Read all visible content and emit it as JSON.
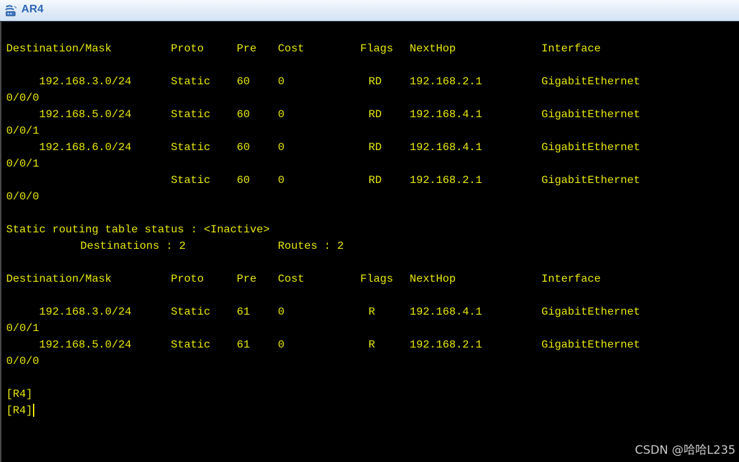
{
  "window": {
    "title": "AR4",
    "icon": "router-icon"
  },
  "table1": {
    "headers": {
      "destination": "Destination/Mask",
      "proto": "Proto",
      "pre": "Pre",
      "cost": "Cost",
      "flags": "Flags",
      "nexthop": "NextHop",
      "interface": "Interface"
    },
    "rows": [
      {
        "destination": "192.168.3.0/24",
        "proto": "Static",
        "pre": "60",
        "cost": "0",
        "flags": "RD",
        "nexthop": "192.168.2.1",
        "interface": "GigabitEthernet",
        "interface_cont": "0/0/0"
      },
      {
        "destination": "192.168.5.0/24",
        "proto": "Static",
        "pre": "60",
        "cost": "0",
        "flags": "RD",
        "nexthop": "192.168.4.1",
        "interface": "GigabitEthernet",
        "interface_cont": "0/0/1"
      },
      {
        "destination": "192.168.6.0/24",
        "proto": "Static",
        "pre": "60",
        "cost": "0",
        "flags": "RD",
        "nexthop": "192.168.4.1",
        "interface": "GigabitEthernet",
        "interface_cont": "0/0/1"
      },
      {
        "destination": "",
        "proto": "Static",
        "pre": "60",
        "cost": "0",
        "flags": "RD",
        "nexthop": "192.168.2.1",
        "interface": "GigabitEthernet",
        "interface_cont": "0/0/0"
      }
    ]
  },
  "status": {
    "line": "Static routing table status : <Inactive>",
    "destinations": "Destinations : 2",
    "routes": "Routes : 2"
  },
  "table2": {
    "headers": {
      "destination": "Destination/Mask",
      "proto": "Proto",
      "pre": "Pre",
      "cost": "Cost",
      "flags": "Flags",
      "nexthop": "NextHop",
      "interface": "Interface"
    },
    "rows": [
      {
        "destination": "192.168.3.0/24",
        "proto": "Static",
        "pre": "61",
        "cost": "0",
        "flags": "R",
        "nexthop": "192.168.4.1",
        "interface": "GigabitEthernet",
        "interface_cont": "0/0/1"
      },
      {
        "destination": "192.168.5.0/24",
        "proto": "Static",
        "pre": "61",
        "cost": "0",
        "flags": "R",
        "nexthop": "192.168.2.1",
        "interface": "GigabitEthernet",
        "interface_cont": "0/0/0"
      }
    ]
  },
  "prompts": [
    "[R4]",
    "[R4]"
  ],
  "watermark": "CSDN @哈哈L235",
  "colors": {
    "terminal_text": "#e8e80a",
    "terminal_bg": "#000000",
    "title_text": "#2f67b4"
  }
}
